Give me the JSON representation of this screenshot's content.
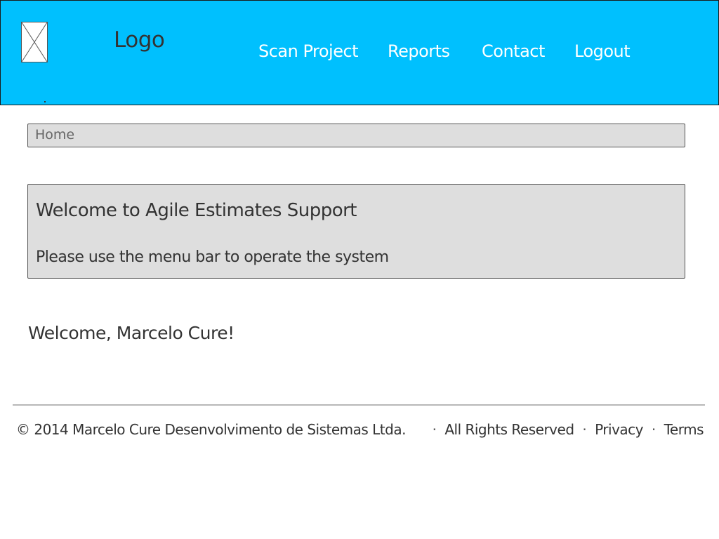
{
  "header": {
    "logo_text": "Logo",
    "background_color": "#00c0fe",
    "nav": [
      {
        "label": "Scan Project"
      },
      {
        "label": "Reports"
      },
      {
        "label": "Contact"
      },
      {
        "label": "Logout"
      }
    ]
  },
  "breadcrumb": {
    "items": [
      {
        "label": "Home"
      }
    ]
  },
  "welcome_panel": {
    "title": "Welcome to Agile Estimates Support",
    "subtitle": "Please use the menu bar to operate the system"
  },
  "user_greeting": "Welcome, Marcelo Cure!",
  "footer": {
    "copyright": "© 2014 Marcelo Cure Desenvolvimento de Sistemas Ltda.",
    "separator": "·",
    "links": [
      {
        "label": "All Rights Reserved"
      },
      {
        "label": "Privacy"
      },
      {
        "label": "Terms"
      }
    ]
  }
}
